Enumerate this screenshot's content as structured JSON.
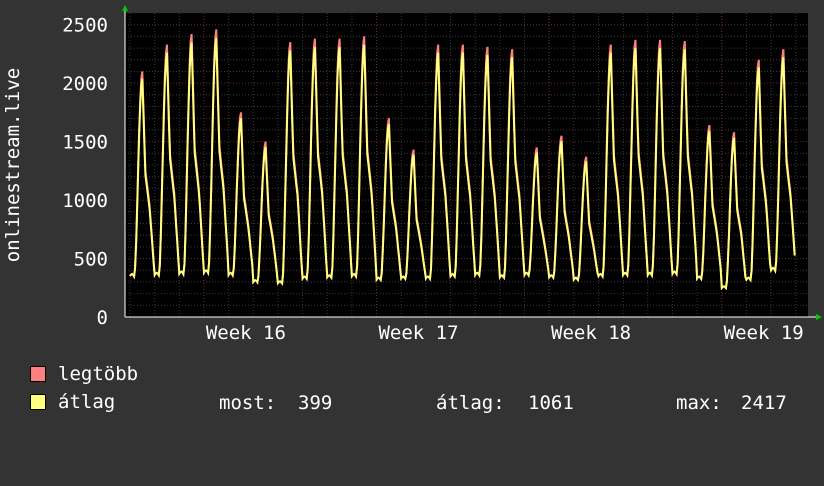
{
  "chart_data": {
    "type": "line",
    "ylabel": "onlinestream.live",
    "ylim": [
      0,
      2600
    ],
    "yticks": [
      0,
      500,
      1000,
      1500,
      2000,
      2500
    ],
    "xticks": [
      "Week 16",
      "Week 17",
      "Week 18",
      "Week 19"
    ],
    "grid": true,
    "colors": {
      "background": "#333333",
      "plot_bg": "#000000",
      "grid_minor": "#3a3a3a",
      "grid_major": "#6a2a2a",
      "series_max": "#ff8080",
      "series_avg": "#ffff80",
      "axis_arrow": "#00cc00"
    },
    "daily_peaks": [
      2100,
      2330,
      2420,
      2460,
      1750,
      1500,
      2350,
      2380,
      2380,
      2400,
      1700,
      1430,
      2330,
      2330,
      2310,
      2290,
      1450,
      1550,
      1370,
      2330,
      2370,
      2370,
      2360,
      1640,
      1580,
      2200,
      2290
    ],
    "daily_troughs": [
      350,
      360,
      370,
      380,
      360,
      300,
      290,
      330,
      340,
      350,
      320,
      330,
      330,
      350,
      360,
      340,
      360,
      340,
      320,
      350,
      360,
      360,
      370,
      330,
      250,
      320,
      400
    ],
    "series": [
      {
        "name": "legtöbb"
      },
      {
        "name": "átlag"
      }
    ],
    "legend": {
      "items": [
        "legtöbb",
        "átlag"
      ],
      "stats": {
        "most_label": "most:",
        "most": "399",
        "atlag_label": "átlag:",
        "atlag": "1061",
        "max_label": "max:",
        "max": "2417"
      }
    }
  }
}
